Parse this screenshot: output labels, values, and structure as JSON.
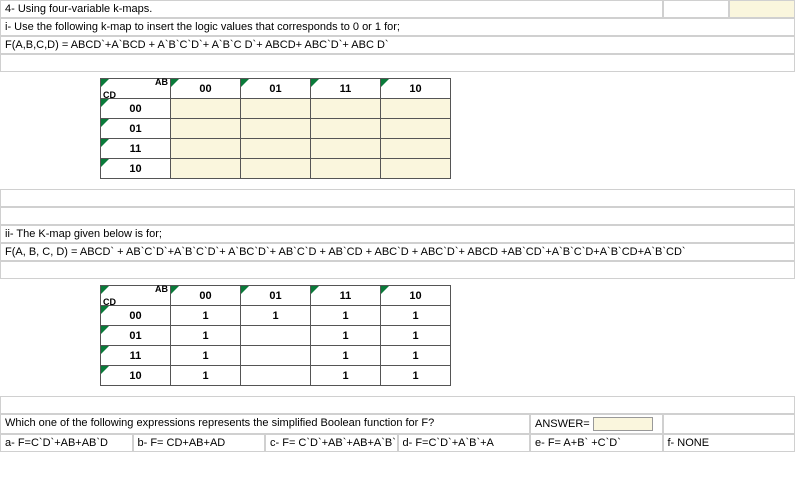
{
  "problem4": {
    "title": "4- Using four-variable k-maps.",
    "part_i": "i-    Use the following k-map to insert the logic values that corresponds to 0 or 1 for;",
    "function_i": "F(A,B,C,D) = ABCD`+A`BCD + A`B`C`D`+ A`B`C D`+ ABCD+ ABC`D`+ ABC D`"
  },
  "kmap1": {
    "corner_ab": "AB",
    "corner_cd": "CD",
    "col_headers": [
      "00",
      "01",
      "11",
      "10"
    ],
    "row_headers": [
      "00",
      "01",
      "11",
      "10"
    ],
    "cells": [
      [
        "",
        "",
        "",
        ""
      ],
      [
        "",
        "",
        "",
        ""
      ],
      [
        "",
        "",
        "",
        ""
      ],
      [
        "",
        "",
        "",
        ""
      ]
    ]
  },
  "part_ii": {
    "title": "ii-    The K-map given below is for;",
    "function_ii": "F(A, B, C, D) = ABCD` + AB`C`D`+A`B`C`D`+ A`BC`D`+ AB`C`D + AB`CD + ABC`D + ABC`D`+ ABCD +AB`CD`+A`B`C`D+A`B`CD+A`B`CD`"
  },
  "kmap2": {
    "corner_ab": "AB",
    "corner_cd": "CD",
    "col_headers": [
      "00",
      "01",
      "11",
      "10"
    ],
    "row_headers": [
      "00",
      "01",
      "11",
      "10"
    ],
    "cells": [
      [
        "1",
        "1",
        "1",
        "1"
      ],
      [
        "1",
        "",
        "1",
        "1"
      ],
      [
        "1",
        "",
        "1",
        "1"
      ],
      [
        "1",
        "",
        "1",
        "1"
      ]
    ]
  },
  "question2": {
    "prompt": "Which one of the following expressions represents the simplified Boolean function for F?",
    "answer_label": "ANSWER=",
    "options": {
      "a": "a- F=C`D`+AB+AB`D",
      "b": "b- F= CD+AB+AD",
      "c": "c- F= C`D`+AB`+AB+A`B`",
      "d": "d- F=C`D`+A`B`+A",
      "e": "e- F= A+B` +C`D`",
      "f": "f- NONE"
    }
  }
}
